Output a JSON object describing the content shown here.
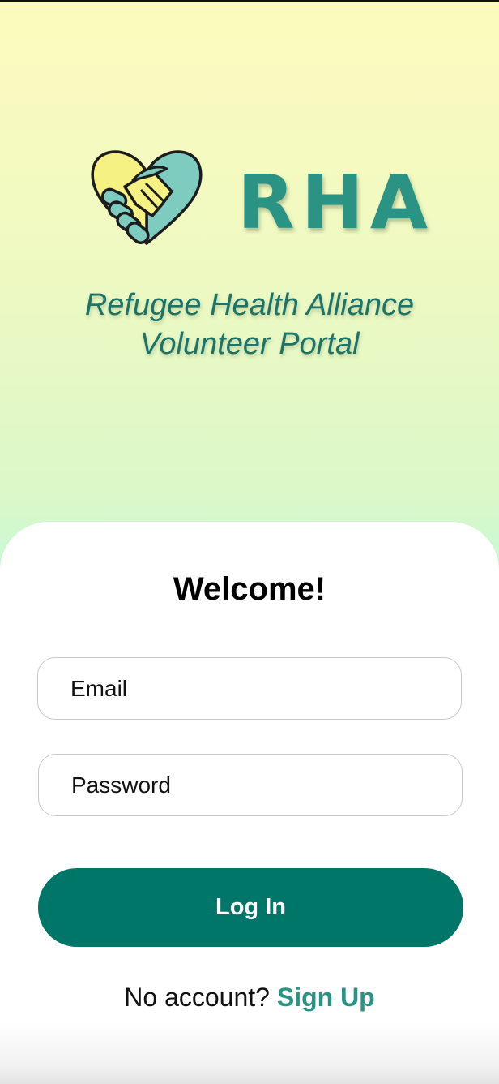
{
  "branding": {
    "logo_icon": "handshake-heart-icon",
    "brand_name": "RHA",
    "tagline_line1": "Refugee Health Alliance",
    "tagline_line2": "Volunteer Portal"
  },
  "login": {
    "heading": "Welcome!",
    "email_placeholder": "Email",
    "email_value": "",
    "password_placeholder": "Password",
    "password_value": "",
    "login_button": "Log In",
    "no_account_text": "No account?",
    "sign_up_link": "Sign Up"
  },
  "colors": {
    "accent": "#007668",
    "brand_teal": "#2a9384",
    "logo_yellow": "#f5f283",
    "logo_teal": "#7ecbbf"
  }
}
